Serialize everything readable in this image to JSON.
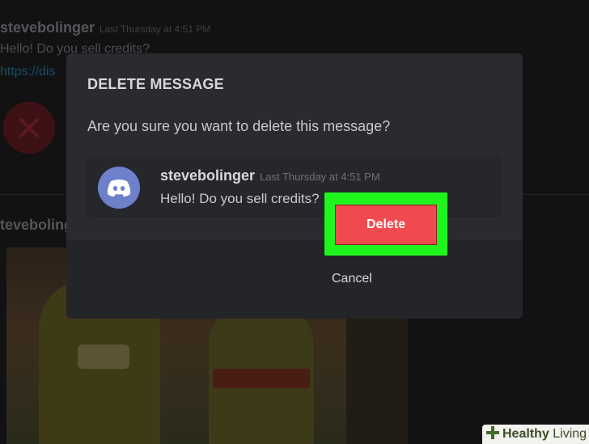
{
  "background": {
    "username": "stevebolinger",
    "timestamp": "Last Thursday at 4:51 PM",
    "message": "Hello! Do you sell credits?",
    "link": "https://dis",
    "username2": "teveboling"
  },
  "dialog": {
    "title": "DELETE MESSAGE",
    "question": "Are you sure you want to delete this message?",
    "preview": {
      "username": "stevebolinger",
      "timestamp": "Last Thursday at 4:51 PM",
      "message": "Hello! Do you sell credits?",
      "avatar_icon": "discord-logo-icon"
    },
    "cancel_label": "Cancel",
    "delete_label": "Delete"
  },
  "colors": {
    "delete_button": "#ef4a4e",
    "highlight": "#1ff51c",
    "avatar": "#6d80c9",
    "modal": "#2a2b2f"
  },
  "watermark": {
    "part1": "Healthy",
    "part2": " Living"
  }
}
